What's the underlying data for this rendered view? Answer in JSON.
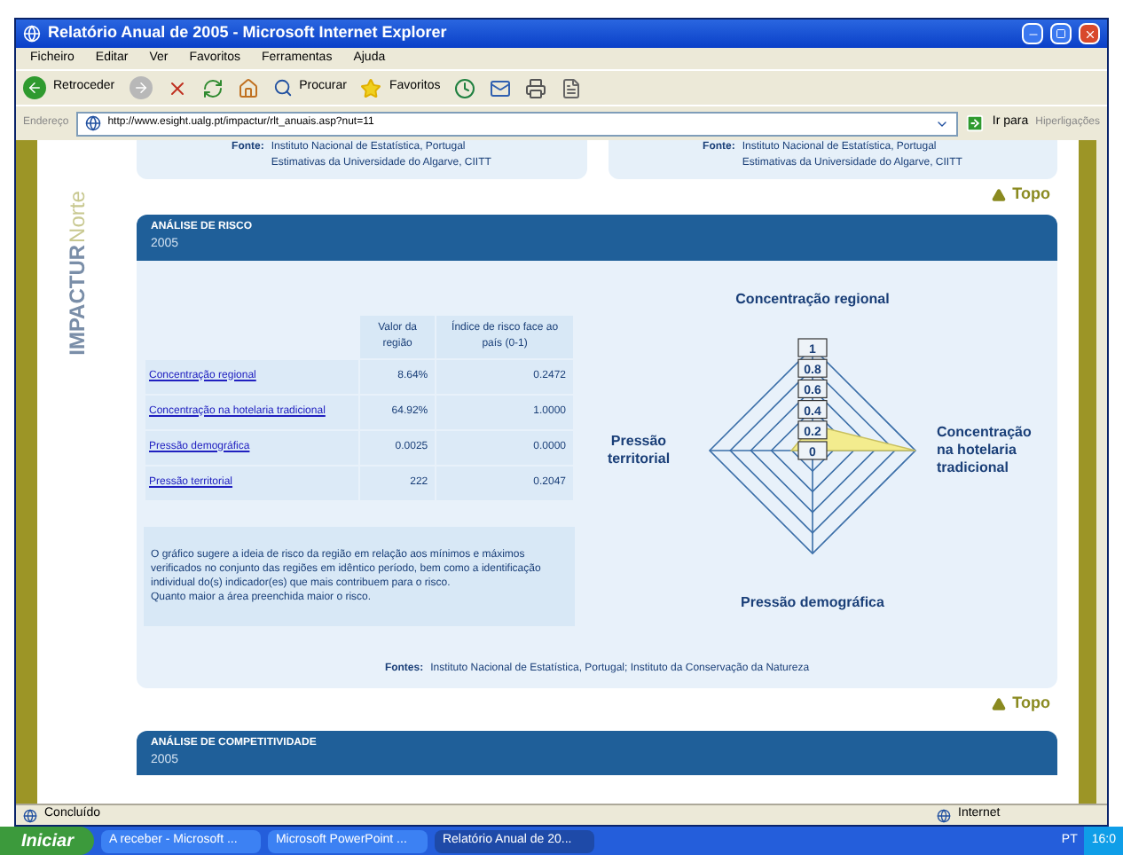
{
  "window": {
    "title": "Relatório Anual de 2005 - Microsoft Internet Explorer"
  },
  "menu": [
    "Ficheiro",
    "Editar",
    "Ver",
    "Favoritos",
    "Ferramentas",
    "Ajuda"
  ],
  "toolbar": {
    "back": "Retroceder",
    "search": "Procurar",
    "favorites": "Favoritos"
  },
  "address": {
    "label": "Endereço",
    "value": "http://www.esight.ualg.pt/impactur/rlt_anuais.asp?nut=11",
    "go": "Ir para",
    "links": "Hiperligações"
  },
  "logo": {
    "main": "IMPACTUR",
    "region": "Norte"
  },
  "top_sources": [
    {
      "label": "Fonte:",
      "lines": [
        "Instituto Nacional de Estatística, Portugal",
        "Estimativas da Universidade do Algarve, CIITT"
      ]
    },
    {
      "label": "Fonte:",
      "lines": [
        "Instituto Nacional de Estatística, Portugal",
        "Estimativas da Universidade do Algarve, CIITT"
      ]
    }
  ],
  "top_link": "Topo",
  "section": {
    "title": "ANÁLISE DE RISCO",
    "year": "2005"
  },
  "table": {
    "columns": [
      "Valor da região",
      "Índice de risco face ao país (0-1)"
    ],
    "rows": [
      {
        "name": "Concentração regional",
        "value": "8.64%",
        "index": "0.2472"
      },
      {
        "name": "Concentração na hotelaria tradicional",
        "value": "64.92%",
        "index": "1.0000"
      },
      {
        "name": "Pressão demográfica",
        "value": "0.0025",
        "index": "0.0000"
      },
      {
        "name": "Pressão territorial",
        "value": "222",
        "index": "0.2047"
      }
    ]
  },
  "note": [
    "O gráfico sugere a ideia de risco da região em relação aos mínimos e máximos verificados no conjunto das regiões em idêntico período, bem como a identificação individual do(s) indicador(es) que mais contribuem para o risco.",
    "Quanto maior a área preenchida maior o risco."
  ],
  "radar": {
    "ticks": [
      "1",
      "0.8",
      "0.6",
      "0.4",
      "0.2",
      "0"
    ],
    "axes": [
      {
        "label": "Concentração regional"
      },
      {
        "label": "Concentração na hotelaria tradicional"
      },
      {
        "label": "Pressão demográfica"
      },
      {
        "label": "Pressão territorial"
      }
    ]
  },
  "sources": {
    "label": "Fontes:",
    "text": "Instituto Nacional de Estatística, Portugal; Instituto da Conservação da Natureza"
  },
  "bottom_link": "Topo",
  "next_section": {
    "title": "ANÁLISE DE COMPETITIVIDADE",
    "year": "2005"
  },
  "status_bar": {
    "text": "Concluído",
    "zone": "Internet"
  },
  "taskbar": {
    "start": "Iniciar",
    "tasks": [
      {
        "label": "A receber - Microsoft ...",
        "selected": false
      },
      {
        "label": "Microsoft PowerPoint ...",
        "selected": false
      },
      {
        "label": "Relatório Anual de 20...",
        "selected": true
      }
    ],
    "language": "PT",
    "clock": "16:0"
  }
}
